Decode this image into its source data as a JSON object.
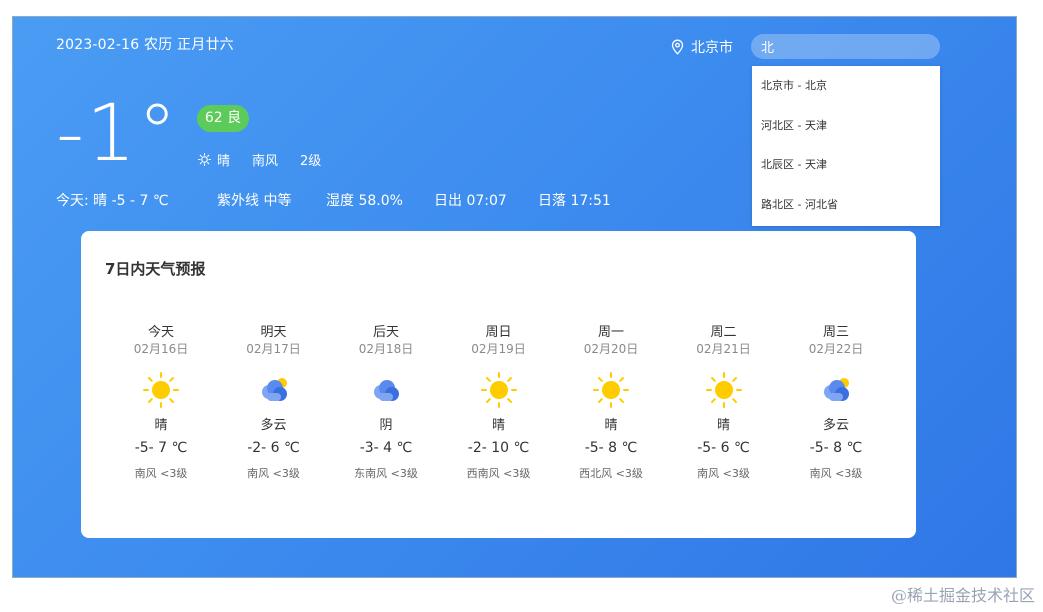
{
  "header": {
    "date": "2023-02-16 农历  正月廿六",
    "city": "北京市",
    "search_value": "北"
  },
  "suggestions": [
    "北京市 - 北京",
    "河北区 - 天津",
    "北辰区 - 天津",
    "路北区 - 河北省"
  ],
  "current": {
    "temp": "-1°",
    "aqi": "62 良",
    "weather": "晴",
    "wind_dir": "南风",
    "wind_level": "2级"
  },
  "today": {
    "summary": "今天:  晴 -5 - 7 ℃",
    "uv": "紫外线 中等",
    "humidity": "湿度 58.0%",
    "sunrise": "日出 07:07",
    "sunset": "日落 17:51"
  },
  "forecast": {
    "title": "7日内天气预报",
    "days": [
      {
        "week": "今天",
        "date": "02月16日",
        "icon": "sun-icon",
        "weather": "晴",
        "range": "-5- 7 ℃",
        "wind": "南风  <3级"
      },
      {
        "week": "明天",
        "date": "02月17日",
        "icon": "partly-cloudy-icon",
        "weather": "多云",
        "range": "-2- 6 ℃",
        "wind": "南风  <3级"
      },
      {
        "week": "后天",
        "date": "02月18日",
        "icon": "overcast-icon",
        "weather": "阴",
        "range": "-3- 4 ℃",
        "wind": "东南风  <3级"
      },
      {
        "week": "周日",
        "date": "02月19日",
        "icon": "sun-icon",
        "weather": "晴",
        "range": "-2- 10 ℃",
        "wind": "西南风  <3级"
      },
      {
        "week": "周一",
        "date": "02月20日",
        "icon": "sun-icon",
        "weather": "晴",
        "range": "-5- 8 ℃",
        "wind": "西北风  <3级"
      },
      {
        "week": "周二",
        "date": "02月21日",
        "icon": "sun-icon",
        "weather": "晴",
        "range": "-5- 6 ℃",
        "wind": "南风  <3级"
      },
      {
        "week": "周三",
        "date": "02月22日",
        "icon": "partly-cloudy-icon",
        "weather": "多云",
        "range": "-5- 8 ℃",
        "wind": "南风  <3级"
      }
    ]
  },
  "watermark": "@稀土掘金技术社区",
  "colors": {
    "sun": "#ffcc00",
    "cloud": "#3b6fe0",
    "aqi_good": "#5ccb5a"
  }
}
